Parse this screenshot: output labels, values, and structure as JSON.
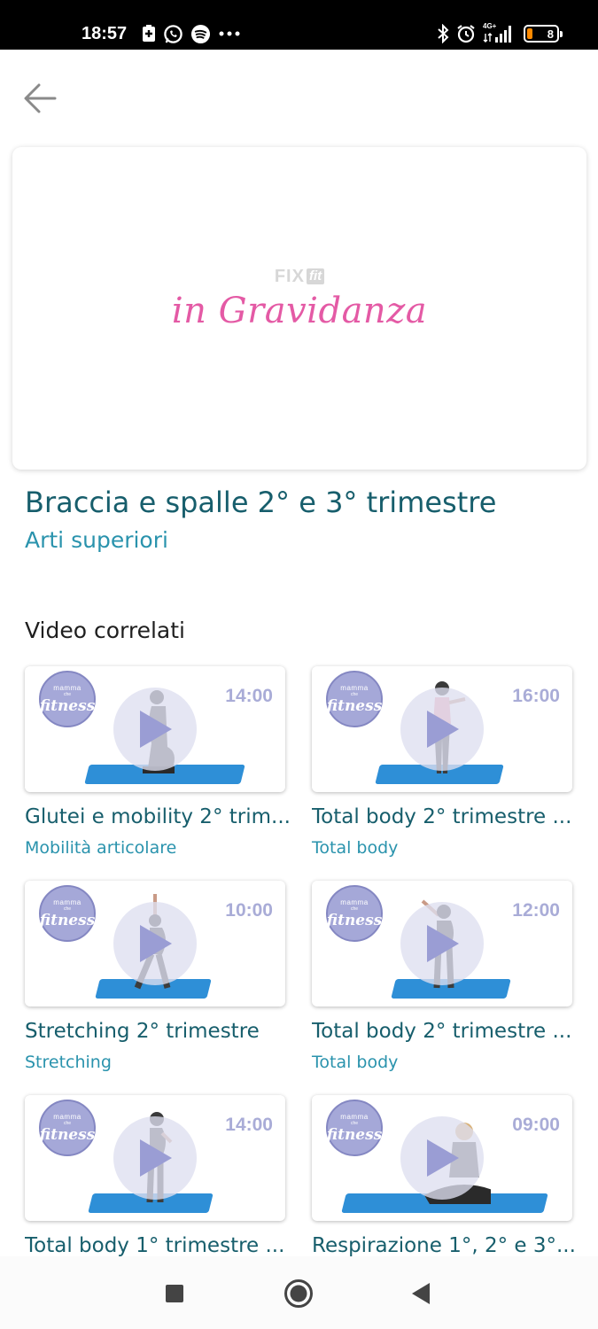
{
  "status_bar": {
    "time": "18:57",
    "left_icons": [
      "sim-card-icon",
      "whatsapp-icon",
      "spotify-icon",
      "more-dots-icon"
    ],
    "right_icons": [
      "bluetooth-icon",
      "alarm-icon",
      "signal-icon",
      "battery-icon"
    ],
    "network": "4G+",
    "battery_level": "8"
  },
  "back_icon": "arrow-left-icon",
  "hero": {
    "brand_fix": "FIX",
    "brand_fit": "fit",
    "script_text": "in Gravidanza"
  },
  "title": "Braccia e spalle 2° e 3° trimestre",
  "subtitle": "Arti superiori",
  "related_heading": "Video correlati",
  "logo": {
    "top": "mamma",
    "small": "che",
    "main": "fitness"
  },
  "colors": {
    "title": "#175e6c",
    "accent": "#2a93ad",
    "logo_badge": "#a5a8d8",
    "mat": "#2e8fd7",
    "hero_script": "#e45aa5"
  },
  "videos": [
    {
      "duration": "14:00",
      "title": "Glutei e mobility 2° trim...",
      "category": "Mobilità articolare"
    },
    {
      "duration": "16:00",
      "title": "Total body 2° trimestre ...",
      "category": "Total body"
    },
    {
      "duration": "10:00",
      "title": "Stretching 2° trimestre",
      "category": "Stretching"
    },
    {
      "duration": "12:00",
      "title": "Total body 2° trimestre ...",
      "category": "Total body"
    },
    {
      "duration": "14:00",
      "title": "Total body 1° trimestre ...",
      "category": ""
    },
    {
      "duration": "09:00",
      "title": "Respirazione 1°, 2° e 3°...",
      "category": ""
    }
  ],
  "nav_bar": {
    "items": [
      "recents-square-icon",
      "home-circle-icon",
      "back-triangle-icon"
    ]
  }
}
